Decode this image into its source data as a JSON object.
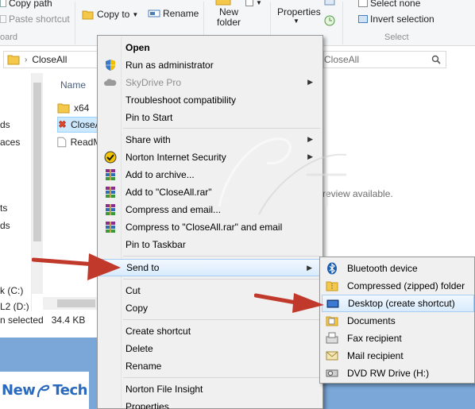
{
  "ribbon": {
    "copy_path": "Copy path",
    "paste_shortcut": "Paste shortcut",
    "copy_to": "Copy to",
    "rename": "Rename",
    "new_folder_line1": "New",
    "new_folder_line2": "folder",
    "properties": "Properties",
    "select_none": "Select none",
    "invert_selection": "Invert selection",
    "group_clipboard": "oard",
    "group_select": "Select"
  },
  "address": {
    "path": "CloseAll",
    "search_text": "CloseAll"
  },
  "nav_pane": {
    "items": [
      "ds",
      "aces",
      "ts",
      "ds",
      "ds",
      "k (C:)",
      "L2 (D:)"
    ]
  },
  "file_list": {
    "column_name": "Name",
    "files": [
      {
        "name": "x64",
        "icon": "folder-icon"
      },
      {
        "name": "CloseAll",
        "icon": "app-icon"
      },
      {
        "name": "ReadMe",
        "icon": "text-file-icon"
      }
    ],
    "preview_text": "review available."
  },
  "status": {
    "selected": "n selected",
    "size": "34.4 KB"
  },
  "context_menu": {
    "items": [
      {
        "label": "Open",
        "bold": true
      },
      {
        "label": "Run as administrator",
        "icon": "uac-shield-icon"
      },
      {
        "label": "SkyDrive Pro",
        "disabled": true,
        "submenu": true,
        "icon": "skydrive-icon"
      },
      {
        "label": "Troubleshoot compatibility"
      },
      {
        "label": "Pin to Start"
      },
      {
        "label": "Share with",
        "submenu": true
      },
      {
        "label": "Norton Internet Security",
        "submenu": true,
        "icon": "norton-icon"
      },
      {
        "label": "Add to archive...",
        "icon": "winrar-icon"
      },
      {
        "label": "Add to \"CloseAll.rar\"",
        "icon": "winrar-icon"
      },
      {
        "label": "Compress and email...",
        "icon": "winrar-icon"
      },
      {
        "label": "Compress to \"CloseAll.rar\" and email",
        "icon": "winrar-icon"
      },
      {
        "label": "Pin to Taskbar"
      },
      {
        "label": "Send to",
        "submenu": true,
        "highlighted": true
      },
      {
        "label": "Cut"
      },
      {
        "label": "Copy"
      },
      {
        "label": "Create shortcut"
      },
      {
        "label": "Delete"
      },
      {
        "label": "Rename"
      },
      {
        "label": "Norton File Insight"
      },
      {
        "label": "Properties"
      }
    ]
  },
  "send_to_menu": {
    "items": [
      {
        "label": "Bluetooth device",
        "icon": "bluetooth-icon"
      },
      {
        "label": "Compressed (zipped) folder",
        "icon": "zip-folder-icon"
      },
      {
        "label": "Desktop (create shortcut)",
        "icon": "desktop-icon",
        "highlighted": true
      },
      {
        "label": "Documents",
        "icon": "documents-icon"
      },
      {
        "label": "Fax recipient",
        "icon": "fax-icon"
      },
      {
        "label": "Mail recipient",
        "icon": "mail-icon"
      },
      {
        "label": "DVD RW Drive (H:)",
        "icon": "dvd-drive-icon"
      }
    ]
  },
  "branding": {
    "logo_left": "New",
    "logo_right": "Tech"
  },
  "colors": {
    "arrow": "#c0392b",
    "highlight": "#d8ebfc",
    "desktop": "#7aa7d8",
    "logo": "#2a6bbd"
  }
}
